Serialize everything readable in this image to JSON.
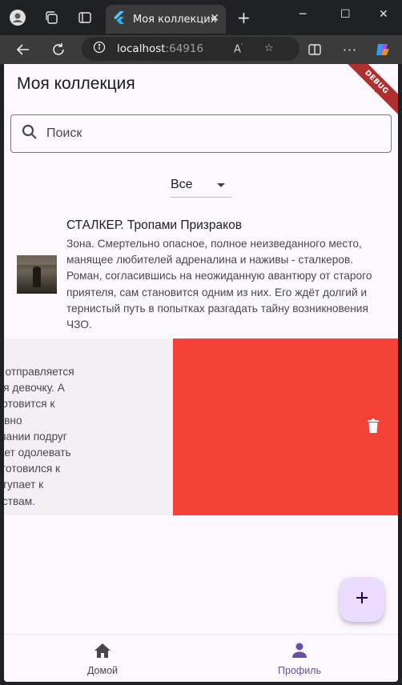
{
  "browser": {
    "tab_title": "Моя коллекция",
    "url_host": "localhost",
    "url_port": ":64916"
  },
  "app": {
    "title": "Моя коллекция",
    "debug_banner": "DEBUG",
    "search": {
      "placeholder": "Поиск"
    },
    "filter": {
      "selected": "Все"
    },
    "items": [
      {
        "title": "СТАЛКЕР. Тропами Призраков",
        "description": "Зона. Смертельно опасное, полное неизведанного место, манящее любителей адреналина и наживы - сталкеров. Роман, согласившись на неожиданную авантюру от старого приятеля, сам становится одним из них. Его ждёт долгий и тернистый путь в попытках разгадать тайну возникновения ЧЗО."
      },
      {
        "description": "н-маньяк Арт отправляется\nхожую на себя девочку. А\nица Сиенна готовится к\nо эскизу недавно\nопится в компании подруг\nвушку начинает одолевать\n Арт тоже подготовился к\nружие и приступает к\nдённым убийствам."
      }
    ],
    "bottom_nav": {
      "home_label": "Домой",
      "profile_label": "Профиль"
    }
  },
  "colors": {
    "background": "#fdf7fe",
    "accent": "#6750a4",
    "delete_bg": "#f44336",
    "fab_bg": "#eaddff"
  }
}
